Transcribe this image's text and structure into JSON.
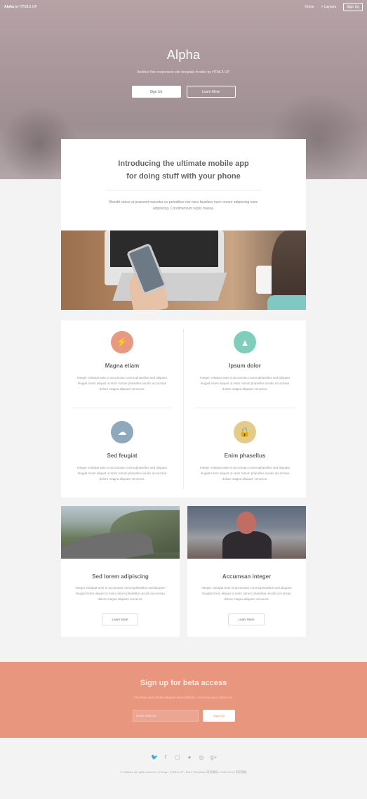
{
  "header": {
    "brand_name": "Alpha",
    "brand_suffix": "by HTML5 UP",
    "nav": {
      "home": "Home",
      "layouts": "Layouts",
      "signup": "Sign Up"
    }
  },
  "hero": {
    "title": "Alpha",
    "subtitle": "Another fine responsive site template freebie by HTML5 UP.",
    "primary_button": "Sign Up",
    "secondary_button": "Learn More"
  },
  "intro": {
    "title_line1": "Introducing the ultimate mobile app",
    "title_line2": "for doing stuff with your phone",
    "text": "Blandit varius ut praesent nascetur eu penatibus nisi risus faucibus nunc ornare adipiscing nunc adipiscing. Condimentum turpis massa."
  },
  "features": [
    {
      "title": "Magna etiam",
      "icon": "bolt-icon",
      "color": "#e89980",
      "glyph": "⚡",
      "text": "Integer volutpat ante et accumsan commophasellus sed aliquam feugiat lorem aliquet ut enim rutrum phasellus iaculis accumsan dolore magna aliquam veroeros."
    },
    {
      "title": "Ipsum dolor",
      "icon": "chart-icon",
      "color": "#7fcdbb",
      "glyph": "▲",
      "text": "Integer volutpat ante et accumsan commophasellus sed aliquam feugiat lorem aliquet ut enim rutrum phasellus iaculis accumsan dolore magna aliquam veroeros."
    },
    {
      "title": "Sed feugiat",
      "icon": "cloud-icon",
      "color": "#8ea9bb",
      "glyph": "☁",
      "text": "Integer volutpat ante et accumsan commophasellus sed aliquam feugiat lorem aliquet ut enim rutrum phasellus iaculis accumsan dolore magna aliquam veroeros."
    },
    {
      "title": "Enim phasellus",
      "icon": "lock-icon",
      "color": "#e5cb8a",
      "glyph": "🔒",
      "text": "Integer volutpat ante et accumsan commophasellus sed aliquam feugiat lorem aliquet ut enim rutrum phasellus iaculis accumsan dolore magna aliquam veroeros."
    }
  ],
  "bottom_cards": [
    {
      "title": "Sed lorem adipiscing",
      "text": "Integer volutpat ante et accumsan commophasellus sed aliquam feugiat lorem aliquet ut enim rutrum phasellus iaculis accumsan dolore magna aliquam veroeros.",
      "button": "Learn More",
      "image": "road-photo"
    },
    {
      "title": "Accumsan integer",
      "text": "Integer volutpat ante et accumsan commophasellus sed aliquam feugiat lorem aliquet ut enim rutrum phasellus iaculis accumsan dolore magna aliquam veroeros.",
      "button": "Learn More",
      "image": "girl-photo"
    }
  ],
  "cta": {
    "title": "Sign up for beta access",
    "text": "Faucibus sed lobortis aliquam lorem blandit. Lorem eu nunc metus col.",
    "email_placeholder": "Email Address",
    "submit": "Sign Up"
  },
  "footer": {
    "social": [
      {
        "icon": "twitter-icon",
        "glyph": "🐦"
      },
      {
        "icon": "facebook-icon",
        "glyph": "f"
      },
      {
        "icon": "instagram-icon",
        "glyph": "◻"
      },
      {
        "icon": "github-icon",
        "glyph": "●"
      },
      {
        "icon": "dribbble-icon",
        "glyph": "◎"
      },
      {
        "icon": "google-plus-icon",
        "glyph": "g+"
      }
    ],
    "copyright": "© Untitled. All rights reserved.  |  Design: HTML5 UP  |  More Templates 网页模板  |  Collect from 网页模板"
  },
  "colors": {
    "accent": "#e9967f",
    "hero": "#a7959a"
  }
}
